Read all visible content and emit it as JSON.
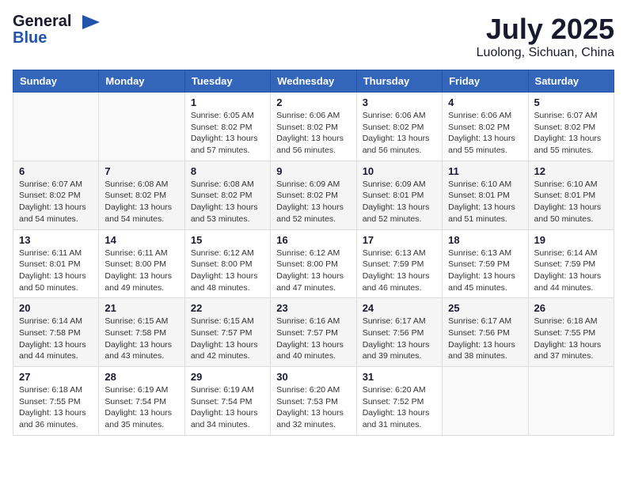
{
  "header": {
    "logo_general": "General",
    "logo_blue": "Blue",
    "month": "July 2025",
    "location": "Luolong, Sichuan, China"
  },
  "weekdays": [
    "Sunday",
    "Monday",
    "Tuesday",
    "Wednesday",
    "Thursday",
    "Friday",
    "Saturday"
  ],
  "weeks": [
    [
      {
        "day": "",
        "info": ""
      },
      {
        "day": "",
        "info": ""
      },
      {
        "day": "1",
        "info": "Sunrise: 6:05 AM\nSunset: 8:02 PM\nDaylight: 13 hours and 57 minutes."
      },
      {
        "day": "2",
        "info": "Sunrise: 6:06 AM\nSunset: 8:02 PM\nDaylight: 13 hours and 56 minutes."
      },
      {
        "day": "3",
        "info": "Sunrise: 6:06 AM\nSunset: 8:02 PM\nDaylight: 13 hours and 56 minutes."
      },
      {
        "day": "4",
        "info": "Sunrise: 6:06 AM\nSunset: 8:02 PM\nDaylight: 13 hours and 55 minutes."
      },
      {
        "day": "5",
        "info": "Sunrise: 6:07 AM\nSunset: 8:02 PM\nDaylight: 13 hours and 55 minutes."
      }
    ],
    [
      {
        "day": "6",
        "info": "Sunrise: 6:07 AM\nSunset: 8:02 PM\nDaylight: 13 hours and 54 minutes."
      },
      {
        "day": "7",
        "info": "Sunrise: 6:08 AM\nSunset: 8:02 PM\nDaylight: 13 hours and 54 minutes."
      },
      {
        "day": "8",
        "info": "Sunrise: 6:08 AM\nSunset: 8:02 PM\nDaylight: 13 hours and 53 minutes."
      },
      {
        "day": "9",
        "info": "Sunrise: 6:09 AM\nSunset: 8:02 PM\nDaylight: 13 hours and 52 minutes."
      },
      {
        "day": "10",
        "info": "Sunrise: 6:09 AM\nSunset: 8:01 PM\nDaylight: 13 hours and 52 minutes."
      },
      {
        "day": "11",
        "info": "Sunrise: 6:10 AM\nSunset: 8:01 PM\nDaylight: 13 hours and 51 minutes."
      },
      {
        "day": "12",
        "info": "Sunrise: 6:10 AM\nSunset: 8:01 PM\nDaylight: 13 hours and 50 minutes."
      }
    ],
    [
      {
        "day": "13",
        "info": "Sunrise: 6:11 AM\nSunset: 8:01 PM\nDaylight: 13 hours and 50 minutes."
      },
      {
        "day": "14",
        "info": "Sunrise: 6:11 AM\nSunset: 8:00 PM\nDaylight: 13 hours and 49 minutes."
      },
      {
        "day": "15",
        "info": "Sunrise: 6:12 AM\nSunset: 8:00 PM\nDaylight: 13 hours and 48 minutes."
      },
      {
        "day": "16",
        "info": "Sunrise: 6:12 AM\nSunset: 8:00 PM\nDaylight: 13 hours and 47 minutes."
      },
      {
        "day": "17",
        "info": "Sunrise: 6:13 AM\nSunset: 7:59 PM\nDaylight: 13 hours and 46 minutes."
      },
      {
        "day": "18",
        "info": "Sunrise: 6:13 AM\nSunset: 7:59 PM\nDaylight: 13 hours and 45 minutes."
      },
      {
        "day": "19",
        "info": "Sunrise: 6:14 AM\nSunset: 7:59 PM\nDaylight: 13 hours and 44 minutes."
      }
    ],
    [
      {
        "day": "20",
        "info": "Sunrise: 6:14 AM\nSunset: 7:58 PM\nDaylight: 13 hours and 44 minutes."
      },
      {
        "day": "21",
        "info": "Sunrise: 6:15 AM\nSunset: 7:58 PM\nDaylight: 13 hours and 43 minutes."
      },
      {
        "day": "22",
        "info": "Sunrise: 6:15 AM\nSunset: 7:57 PM\nDaylight: 13 hours and 42 minutes."
      },
      {
        "day": "23",
        "info": "Sunrise: 6:16 AM\nSunset: 7:57 PM\nDaylight: 13 hours and 40 minutes."
      },
      {
        "day": "24",
        "info": "Sunrise: 6:17 AM\nSunset: 7:56 PM\nDaylight: 13 hours and 39 minutes."
      },
      {
        "day": "25",
        "info": "Sunrise: 6:17 AM\nSunset: 7:56 PM\nDaylight: 13 hours and 38 minutes."
      },
      {
        "day": "26",
        "info": "Sunrise: 6:18 AM\nSunset: 7:55 PM\nDaylight: 13 hours and 37 minutes."
      }
    ],
    [
      {
        "day": "27",
        "info": "Sunrise: 6:18 AM\nSunset: 7:55 PM\nDaylight: 13 hours and 36 minutes."
      },
      {
        "day": "28",
        "info": "Sunrise: 6:19 AM\nSunset: 7:54 PM\nDaylight: 13 hours and 35 minutes."
      },
      {
        "day": "29",
        "info": "Sunrise: 6:19 AM\nSunset: 7:54 PM\nDaylight: 13 hours and 34 minutes."
      },
      {
        "day": "30",
        "info": "Sunrise: 6:20 AM\nSunset: 7:53 PM\nDaylight: 13 hours and 32 minutes."
      },
      {
        "day": "31",
        "info": "Sunrise: 6:20 AM\nSunset: 7:52 PM\nDaylight: 13 hours and 31 minutes."
      },
      {
        "day": "",
        "info": ""
      },
      {
        "day": "",
        "info": ""
      }
    ]
  ]
}
